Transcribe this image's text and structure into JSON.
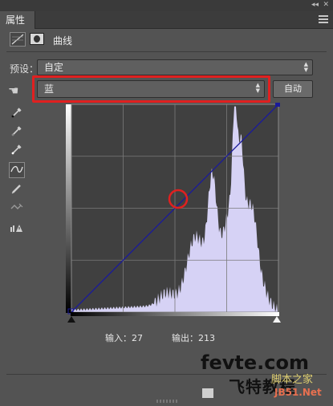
{
  "panel": {
    "tab_label": "属性",
    "collapse_glyph": "◂◂",
    "close_glyph": "✕",
    "title": "曲线"
  },
  "preset": {
    "label": "预设：",
    "value": "自定"
  },
  "channel": {
    "value": "蓝",
    "auto_label": "自动"
  },
  "tools": [
    {
      "name": "eyedropper-black-point-icon"
    },
    {
      "name": "eyedropper-gray-point-icon"
    },
    {
      "name": "eyedropper-white-point-icon"
    },
    {
      "name": "curve-points-tool-icon",
      "active": true
    },
    {
      "name": "pencil-tool-icon"
    },
    {
      "name": "smooth-curve-icon"
    },
    {
      "name": "clipping-warning-icon"
    }
  ],
  "readout": {
    "input_label": "输入：27",
    "output_label": "输出：213"
  },
  "watermark": {
    "line1": "fevte.com",
    "line2": "飞特教程",
    "line3": "脚本之家",
    "line4": "JB51.Net"
  },
  "colors": {
    "histogram": "#d6d2f5",
    "curve": "#1a1a9a",
    "highlight": "#e02020"
  }
}
